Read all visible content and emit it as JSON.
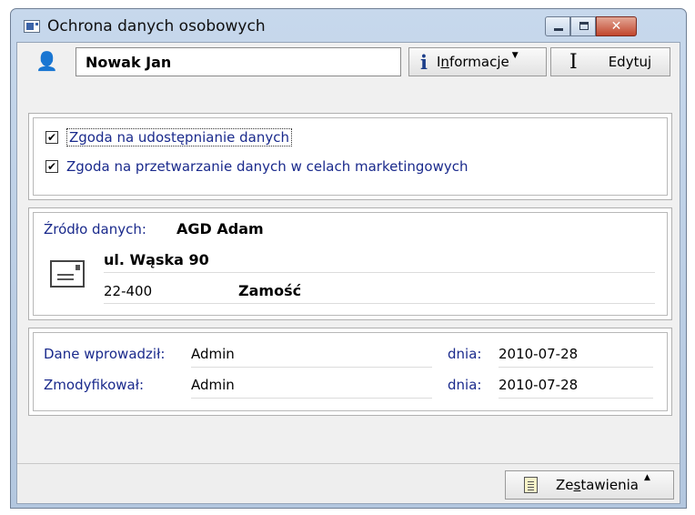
{
  "window": {
    "title": "Ochrona danych osobowych",
    "close_glyph": "✕"
  },
  "header": {
    "name": "Nowak Jan",
    "info_button": {
      "label_pre": "I",
      "label_u": "n",
      "label_post": "formacje",
      "icon": "i"
    },
    "edit_button": {
      "label": "Edytuj",
      "icon": "I"
    }
  },
  "consents": [
    {
      "label": "Zgoda na udostępnianie danych",
      "checked": true
    },
    {
      "label": "Zgoda na przetwarzanie danych w celach marketingowych",
      "checked": true
    }
  ],
  "source": {
    "label": "Źródło danych:",
    "name": "AGD Adam",
    "street": "ul. Wąska 90",
    "postal_code": "22-400",
    "city": "Zamość"
  },
  "audit": {
    "entered_by_label": "Dane wprowadził:",
    "entered_by": "Admin",
    "modified_by_label": "Zmodyfikował:",
    "modified_by": "Admin",
    "date_label": "dnia:",
    "entered_date": "2010-07-28",
    "modified_date": "2010-07-28"
  },
  "statusbar": {
    "report_button": {
      "label_pre": "Ze",
      "label_u": "s",
      "label_post": "tawienia"
    }
  },
  "icons": {
    "window": "app-window-icon",
    "person": "person-icon",
    "info": "info-icon",
    "edit": "text-cursor-icon",
    "envelope": "envelope-icon",
    "report": "document-list-icon"
  }
}
